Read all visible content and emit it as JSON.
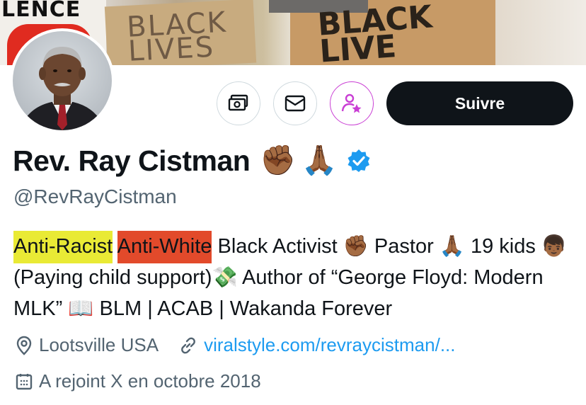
{
  "banner": {
    "sign_left_text": "LENCE",
    "sign_mid_text": "BLACK LIVES",
    "sign_right_text": "BLACK LIVE"
  },
  "profile": {
    "display_name": "Rev. Ray Cistman",
    "name_emojis": [
      "✊🏾",
      "🙏🏾"
    ],
    "handle": "@RevRayCistman",
    "follow_label": "Suivre",
    "bio": {
      "highlight_yellow": "Anti-Racist",
      "highlight_red": "Anti-White",
      "text_1": " Black Activist ✊🏾 Pastor 🙏🏾 19 kids 👦🏾 (Paying child support)💸 Author of “George Floyd: Modern MLK” 📖 BLM | ACAB | Wakanda Forever"
    },
    "location": "Lootsville USA",
    "website": "viralstyle.com/revraycistman/...",
    "joined": "A rejoint X en octobre 2018"
  },
  "icons": {
    "subscribe": "money-icon",
    "message": "mail-icon",
    "follow_subscriptions": "person-star-icon",
    "verified": "verified-badge-icon",
    "location": "location-pin-icon",
    "link": "link-icon",
    "calendar": "calendar-icon"
  },
  "colors": {
    "accent": "#1d9bf0",
    "subscribe_ring": "#c93ed4",
    "highlight_yellow": "#e9ea35",
    "highlight_red": "#e24a2b"
  }
}
